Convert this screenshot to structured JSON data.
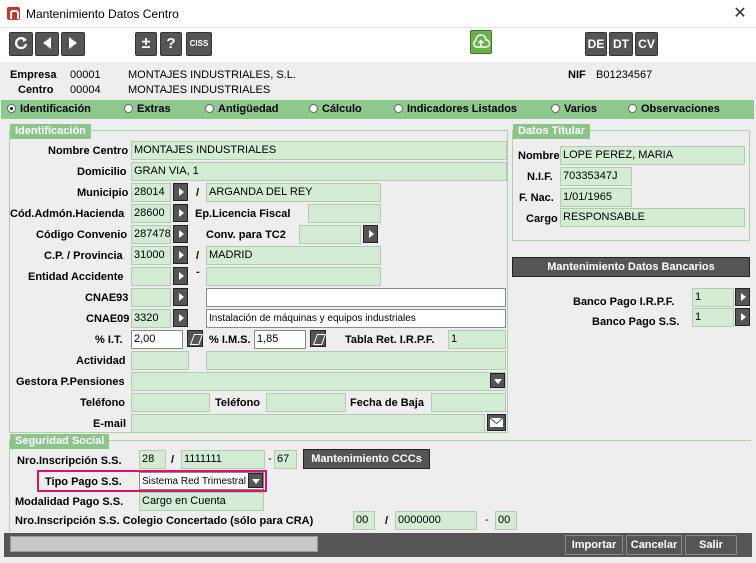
{
  "window": {
    "title": "Mantenimiento Datos Centro",
    "close": "✕"
  },
  "toolbar": {
    "plus": "±",
    "help": "?",
    "ciss": "CISS",
    "de": "DE",
    "dt": "DT",
    "cv": "CV"
  },
  "header": {
    "empresa_label": "Empresa",
    "empresa_code": "00001",
    "empresa_name": "MONTAJES INDUSTRIALES, S.L.",
    "centro_label": "Centro",
    "centro_code": "00004",
    "centro_name": "MONTAJES INDUSTRIALES",
    "nif_label": "NIF",
    "nif_value": "B01234567"
  },
  "tabs": [
    "Identificación",
    "Extras",
    "Antigüedad",
    "Cálculo",
    "Indicadores Listados",
    "Varios",
    "Observaciones"
  ],
  "ident": {
    "title": "Identificación",
    "nombre_centro_label": "Nombre Centro",
    "nombre_centro": "MONTAJES INDUSTRIALES",
    "domicilio_label": "Domicilio",
    "domicilio": "GRAN VIA, 1",
    "municipio_label": "Municipio",
    "municipio_code": "28014",
    "municipio_name": "ARGANDA DEL REY",
    "cod_hacienda_label": "Cód.Admón.Hacienda",
    "cod_hacienda": "28600",
    "ep_licencia_label": "Ep.Licencia Fiscal",
    "ep_licencia": "",
    "convenio_label": "Código Convenio",
    "convenio": "287478",
    "conv_tc2_label": "Conv. para TC2",
    "conv_tc2": "",
    "cp_label": "C.P. / Provincia",
    "cp": "31000",
    "provincia": "MADRID",
    "entidad_label": "Entidad Accidente",
    "entidad_code": "",
    "entidad_name": "",
    "cnae93_label": "CNAE93",
    "cnae93_code": "",
    "cnae93_desc": "",
    "cnae09_label": "CNAE09",
    "cnae09_code": "3320",
    "cnae09_desc": "Instalación de máquinas y equipos industriales",
    "it_label": "% I.T.",
    "it": "2,00",
    "ims_label": "% I.M.S.",
    "ims": "1,85",
    "tabla_irpf_label": "Tabla Ret. I.R.P.F.",
    "tabla_irpf": "1",
    "actividad_label": "Actividad",
    "actividad_code": "",
    "actividad_desc": "",
    "gestora_label": "Gestora P.Pensiones",
    "gestora": "",
    "telefono_label": "Teléfono",
    "telefono": "",
    "telefono2_label": "Teléfono",
    "telefono2": "",
    "fecha_baja_label": "Fecha de Baja",
    "fecha_baja": "",
    "email_label": "E-mail",
    "email": ""
  },
  "titular": {
    "title": "Datos Titular",
    "nombre_label": "Nombre",
    "nombre": "LOPE PEREZ, MARIA",
    "nif_label": "N.I.F.",
    "nif": "70335347J",
    "fnac_label": "F. Nac.",
    "fnac": "1/01/1965",
    "cargo_label": "Cargo",
    "cargo": "RESPONSABLE"
  },
  "bancos": {
    "button": "Mantenimiento Datos Bancarios",
    "irpf_label": "Banco Pago I.R.P.F.",
    "irpf": "1",
    "ss_label": "Banco Pago S.S.",
    "ss": "1"
  },
  "ss": {
    "title": "Seguridad Social",
    "nro_label": "Nro.Inscripción S.S.",
    "nro_a": "28",
    "nro_b": "1111111",
    "nro_c": "67",
    "ccc_button": "Mantenimiento CCCs",
    "tipo_label": "Tipo Pago S.S.",
    "tipo": "Sistema Red Trimestral",
    "modalidad_label": "Modalidad Pago S.S.",
    "modalidad": "Cargo en Cuenta",
    "colegio_label": "Nro.Inscripción S.S. Colegio Concertado (sólo para CRA)",
    "colegio_a": "00",
    "colegio_b": "0000000",
    "colegio_c": "00"
  },
  "footer": {
    "importar": "Importar",
    "cancelar": "Cancelar",
    "salir": "Salir"
  }
}
